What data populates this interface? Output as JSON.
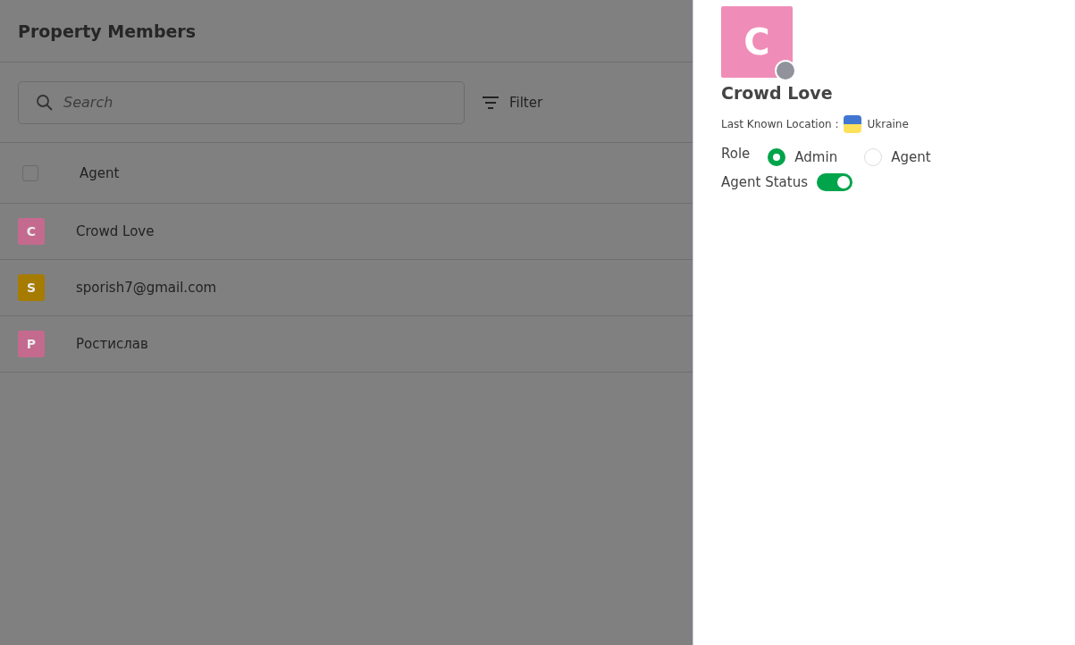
{
  "page": {
    "title": "Property Members"
  },
  "search": {
    "placeholder": "Search"
  },
  "filter": {
    "label": "Filter"
  },
  "table": {
    "select_all": {
      "checked": false
    },
    "columns": [
      "Agent"
    ],
    "rows": [
      {
        "initial": "C",
        "name": "Crowd Love",
        "color": "#c46a8f"
      },
      {
        "initial": "S",
        "name": "sporish7@gmail.com",
        "color": "#a57b00"
      },
      {
        "initial": "Р",
        "name": "Ростислав",
        "color": "#c46a8f"
      }
    ]
  },
  "drawer": {
    "avatar": {
      "initial": "C",
      "color": "#f08cb8"
    },
    "name": "Crowd Love",
    "location_label": "Last Known Location :",
    "location": "Ukraine",
    "role_label": "Role",
    "roles": [
      {
        "label": "Admin",
        "selected": true
      },
      {
        "label": "Agent",
        "selected": false
      }
    ],
    "status_label": "Agent Status",
    "status": {
      "on": true
    }
  }
}
